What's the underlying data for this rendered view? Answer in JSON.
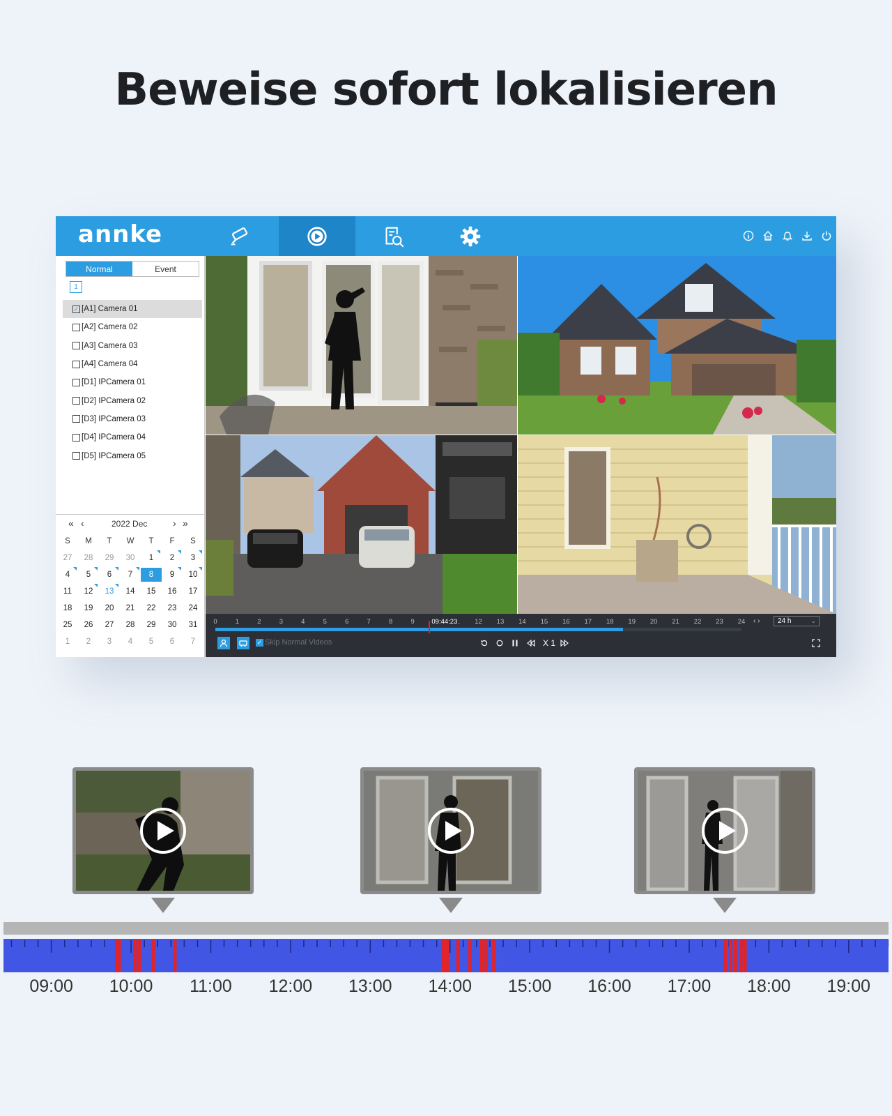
{
  "headline": "Beweise sofort lokalisieren",
  "app": {
    "logo": "annke",
    "nav_tabs": [
      {
        "icon": "camera-icon",
        "active": false
      },
      {
        "icon": "playback-icon",
        "active": true
      },
      {
        "icon": "search-file-icon",
        "active": false
      },
      {
        "icon": "gear-icon",
        "active": false
      }
    ],
    "top_icons": [
      "info-icon",
      "home-icon",
      "bell-icon",
      "download-icon",
      "power-icon"
    ],
    "mode_tabs": [
      "Normal",
      "Event"
    ],
    "active_mode": "Normal",
    "group_badge": "1",
    "cameras": [
      {
        "label": "[A1] Camera 01",
        "checked": true
      },
      {
        "label": "[A2] Camera 02",
        "checked": false
      },
      {
        "label": "[A3] Camera 03",
        "checked": false
      },
      {
        "label": "[A4] Camera 04",
        "checked": false
      },
      {
        "label": "[D1] IPCamera 01",
        "checked": false
      },
      {
        "label": "[D2] IPCamera 02",
        "checked": false
      },
      {
        "label": "[D3] IPCamera 03",
        "checked": false
      },
      {
        "label": "[D4] IPCamera 04",
        "checked": false
      },
      {
        "label": "[D5] IPCamera 05",
        "checked": false
      }
    ],
    "calendar": {
      "title": "2022 Dec",
      "prev_year": "«",
      "prev_month": "‹",
      "next_month": "›",
      "next_year": "»",
      "weekdays": [
        "S",
        "M",
        "T",
        "W",
        "T",
        "F",
        "S"
      ],
      "days": [
        "27",
        "28",
        "29",
        "30",
        "1",
        "2",
        "3",
        "4",
        "5",
        "6",
        "7",
        "8",
        "9",
        "10",
        "11",
        "12",
        "13",
        "14",
        "15",
        "16",
        "17",
        "18",
        "19",
        "20",
        "21",
        "22",
        "23",
        "24",
        "25",
        "26",
        "27",
        "28",
        "29",
        "30",
        "31",
        "1",
        "2",
        "3",
        "4",
        "5",
        "6",
        "7"
      ],
      "dim_indices": [
        0,
        1,
        2,
        3,
        35,
        36,
        37,
        38,
        39,
        40,
        41
      ],
      "selected_day": "8",
      "today_day": "13",
      "recorded_days": [
        "1",
        "2",
        "3",
        "4",
        "5",
        "6",
        "7",
        "8",
        "9",
        "10",
        "12",
        "13"
      ]
    },
    "playback": {
      "hour_labels": [
        "0",
        "1",
        "2",
        "3",
        "4",
        "5",
        "6",
        "7",
        "8",
        "9",
        "10",
        "11",
        "12",
        "13",
        "14",
        "15",
        "16",
        "17",
        "18",
        "19",
        "20",
        "21",
        "22",
        "23",
        "24"
      ],
      "current_time": "09:44:23",
      "current_hour": 9.74,
      "recorded_until_hour": 18.6,
      "range": "24 h",
      "skip_label": "Skip Normal Videos",
      "skip_checked": true,
      "speed": "X 1"
    },
    "colors": {
      "accent": "#2b9de0",
      "marker": "#e0242a"
    }
  },
  "bottom_timeline": {
    "labels": [
      "09:00",
      "10:00",
      "11:00",
      "12:00",
      "13:00",
      "14:00",
      "15:00",
      "16:00",
      "17:00",
      "18:00",
      "19:00"
    ],
    "start_hour": 8.4,
    "end_hour": 19.5,
    "event_hours": [
      9.82,
      9.85,
      10.05,
      10.1,
      10.28,
      10.55,
      13.92,
      13.97,
      14.1,
      14.25,
      14.4,
      14.45,
      14.55,
      17.45,
      17.52,
      17.58,
      17.65,
      17.7
    ],
    "colors": {
      "track": "#4256e6",
      "event": "#e0242a",
      "rail": "#b5b5b5"
    }
  }
}
